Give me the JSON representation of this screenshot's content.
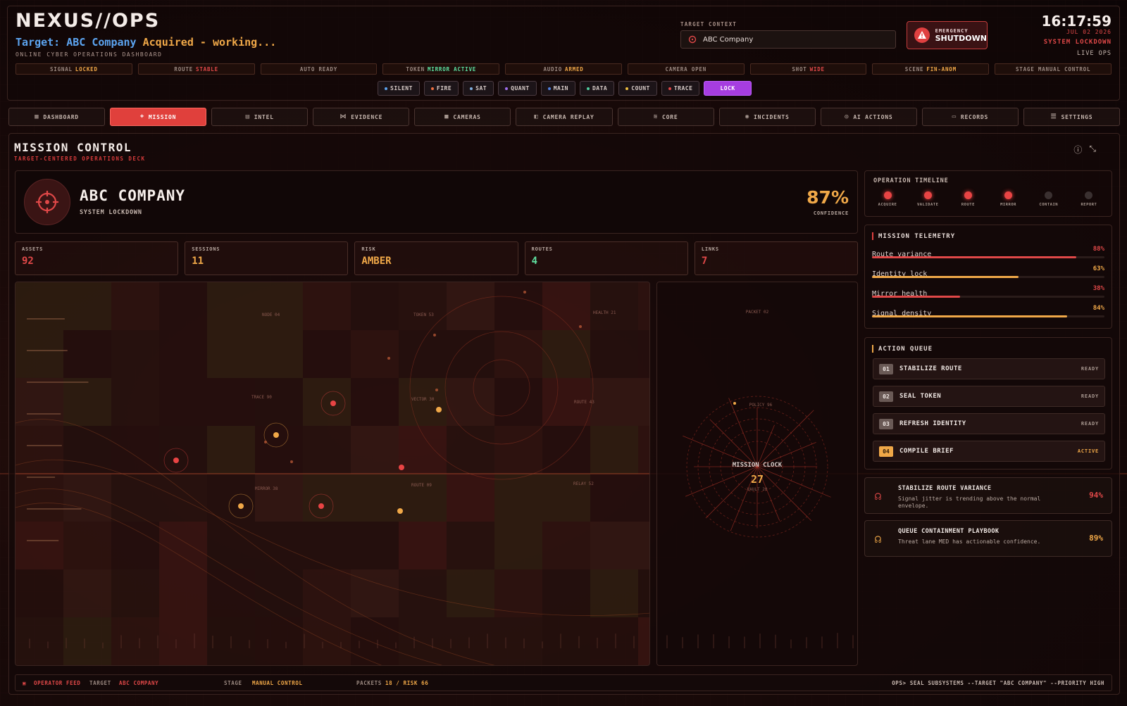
{
  "header": {
    "brand": "NEXUS//OPS",
    "target_prefix": "Target:",
    "target_name": "ABC Company",
    "target_status": "Acquired - working...",
    "subtitle": "ONLINE CYBER OPERATIONS DASHBOARD",
    "context_label": "TARGET CONTEXT",
    "context_value": "ABC Company",
    "emergency_line1": "EMERGENCY",
    "emergency_line2": "SHUTDOWN",
    "clock": "16:17:59",
    "date": "JUL 02 2026",
    "system_state": "SYSTEM LOCKDOWN",
    "live": "LIVE OPS"
  },
  "status_strip": [
    {
      "label": "SIGNAL",
      "value": "LOCKED",
      "color": "#f0a848"
    },
    {
      "label": "ROUTE",
      "value": "STABLE",
      "color": "#e04848"
    },
    {
      "label": "AUTO READY",
      "value": "",
      "color": "#9a8880"
    },
    {
      "label": "TOKEN",
      "value": "MIRROR ACTIVE",
      "color": "#5ce0a0"
    },
    {
      "label": "AUDIO",
      "value": "ARMED",
      "color": "#f0a848"
    },
    {
      "label": "CAMERA OPEN",
      "value": "",
      "color": "#9a8880"
    },
    {
      "label": "SHOT",
      "value": "WIDE",
      "color": "#e04848"
    },
    {
      "label": "SCENE",
      "value": "FIN-ANOM",
      "color": "#f0a848"
    },
    {
      "label": "STAGE MANUAL CONTROL",
      "value": "",
      "color": "#9a8880"
    }
  ],
  "chips": [
    {
      "label": "SILENT",
      "dot": "#5ca4f0"
    },
    {
      "label": "FIRE",
      "dot": "#f07040"
    },
    {
      "label": "SAT",
      "dot": "#80b0e0"
    },
    {
      "label": "QUANT",
      "dot": "#a070f0"
    },
    {
      "label": "MAIN",
      "dot": "#5080e0"
    },
    {
      "label": "DATA",
      "dot": "#50d0a0"
    },
    {
      "label": "COUNT",
      "dot": "#f0c040"
    },
    {
      "label": "TRACE",
      "dot": "#e04848"
    },
    {
      "label": "LOCK",
      "dot": ""
    }
  ],
  "nav": [
    {
      "label": "DASHBOARD",
      "icon": "▦",
      "active": false
    },
    {
      "label": "MISSION",
      "icon": "⌖",
      "active": true
    },
    {
      "label": "INTEL",
      "icon": "▤",
      "active": false
    },
    {
      "label": "EVIDENCE",
      "icon": "⋈",
      "active": false
    },
    {
      "label": "CAMERAS",
      "icon": "■",
      "active": false
    },
    {
      "label": "CAMERA REPLAY",
      "icon": "◧",
      "active": false
    },
    {
      "label": "CORE",
      "icon": "≋",
      "active": false
    },
    {
      "label": "INCIDENTS",
      "icon": "◉",
      "active": false
    },
    {
      "label": "AI ACTIONS",
      "icon": "◎",
      "active": false
    },
    {
      "label": "RECORDS",
      "icon": "▭",
      "active": false
    },
    {
      "label": "SETTINGS",
      "icon": "☰",
      "active": false
    }
  ],
  "mission": {
    "title": "MISSION CONTROL",
    "subtitle": "TARGET-CENTERED OPERATIONS DECK",
    "company": "ABC COMPANY",
    "state": "SYSTEM LOCKDOWN",
    "confidence": "87%",
    "confidence_label": "CONFIDENCE"
  },
  "metrics": [
    {
      "label": "ASSETS",
      "value": "92",
      "color": "#e04848"
    },
    {
      "label": "SESSIONS",
      "value": "11",
      "color": "#f0a848"
    },
    {
      "label": "RISK",
      "value": "AMBER",
      "color": "#f0a848"
    },
    {
      "label": "ROUTES",
      "value": "4",
      "color": "#60e0a0"
    },
    {
      "label": "LINKS",
      "value": "7",
      "color": "#e04848"
    }
  ],
  "map_labels": [
    "NODE 04",
    "TOKEN 53",
    "HEALTH 21",
    "TRACE 90",
    "VECTOR 30",
    "ROUTE 43",
    "MIRROR 38",
    "ROUTE 09",
    "RELAY 52"
  ],
  "mission_clock": {
    "label": "MISSION CLOCK",
    "value": "27",
    "packet_label": "PACKET 02",
    "policy_label": "POLICY 96",
    "vault_label": "VAULT 20"
  },
  "timeline": {
    "title": "OPERATION TIMELINE",
    "steps": [
      {
        "label": "ACQUIRE",
        "done": true
      },
      {
        "label": "VALIDATE",
        "done": true
      },
      {
        "label": "ROUTE",
        "done": true
      },
      {
        "label": "MIRROR",
        "done": true
      },
      {
        "label": "CONTAIN",
        "done": false
      },
      {
        "label": "REPORT",
        "done": false
      }
    ]
  },
  "telemetry": {
    "title": "MISSION TELEMETRY",
    "rows": [
      {
        "name": "Route variance",
        "value": "88%",
        "pct": 88,
        "color": "#e04848"
      },
      {
        "name": "Identity lock",
        "value": "63%",
        "pct": 63,
        "color": "#f0a848"
      },
      {
        "name": "Mirror health",
        "value": "38%",
        "pct": 38,
        "color": "#e04848"
      },
      {
        "name": "Signal density",
        "value": "84%",
        "pct": 84,
        "color": "#f0a848"
      }
    ]
  },
  "action_queue": {
    "title": "ACTION QUEUE",
    "items": [
      {
        "num": "01",
        "label": "STABILIZE ROUTE",
        "status": "READY",
        "active": false
      },
      {
        "num": "02",
        "label": "SEAL TOKEN",
        "status": "READY",
        "active": false
      },
      {
        "num": "03",
        "label": "REFRESH IDENTITY",
        "status": "READY",
        "active": false
      },
      {
        "num": "04",
        "label": "COMPILE BRIEF",
        "status": "ACTIVE",
        "active": true
      }
    ]
  },
  "recommendations": [
    {
      "title": "STABILIZE ROUTE VARIANCE",
      "desc": "Signal jitter is trending above the normal envelope.",
      "pct": "94%",
      "color": "#e04848",
      "icon": "brain-icon"
    },
    {
      "title": "QUEUE CONTAINMENT PLAYBOOK",
      "desc": "Threat lane MED has actionable confidence.",
      "pct": "89%",
      "color": "#f0a848",
      "icon": "brain-icon"
    }
  ],
  "footer": {
    "feed_label": "OPERATOR FEED",
    "target_label": "TARGET",
    "target_value": "ABC COMPANY",
    "stage_label": "STAGE",
    "stage_value": "MANUAL CONTROL",
    "packets_label": "PACKETS",
    "packets_value": "18 / RISK 66",
    "command": "OPS> SEAL SUBSYSTEMS --TARGET \"ABC COMPANY\" --PRIORITY HIGH"
  }
}
